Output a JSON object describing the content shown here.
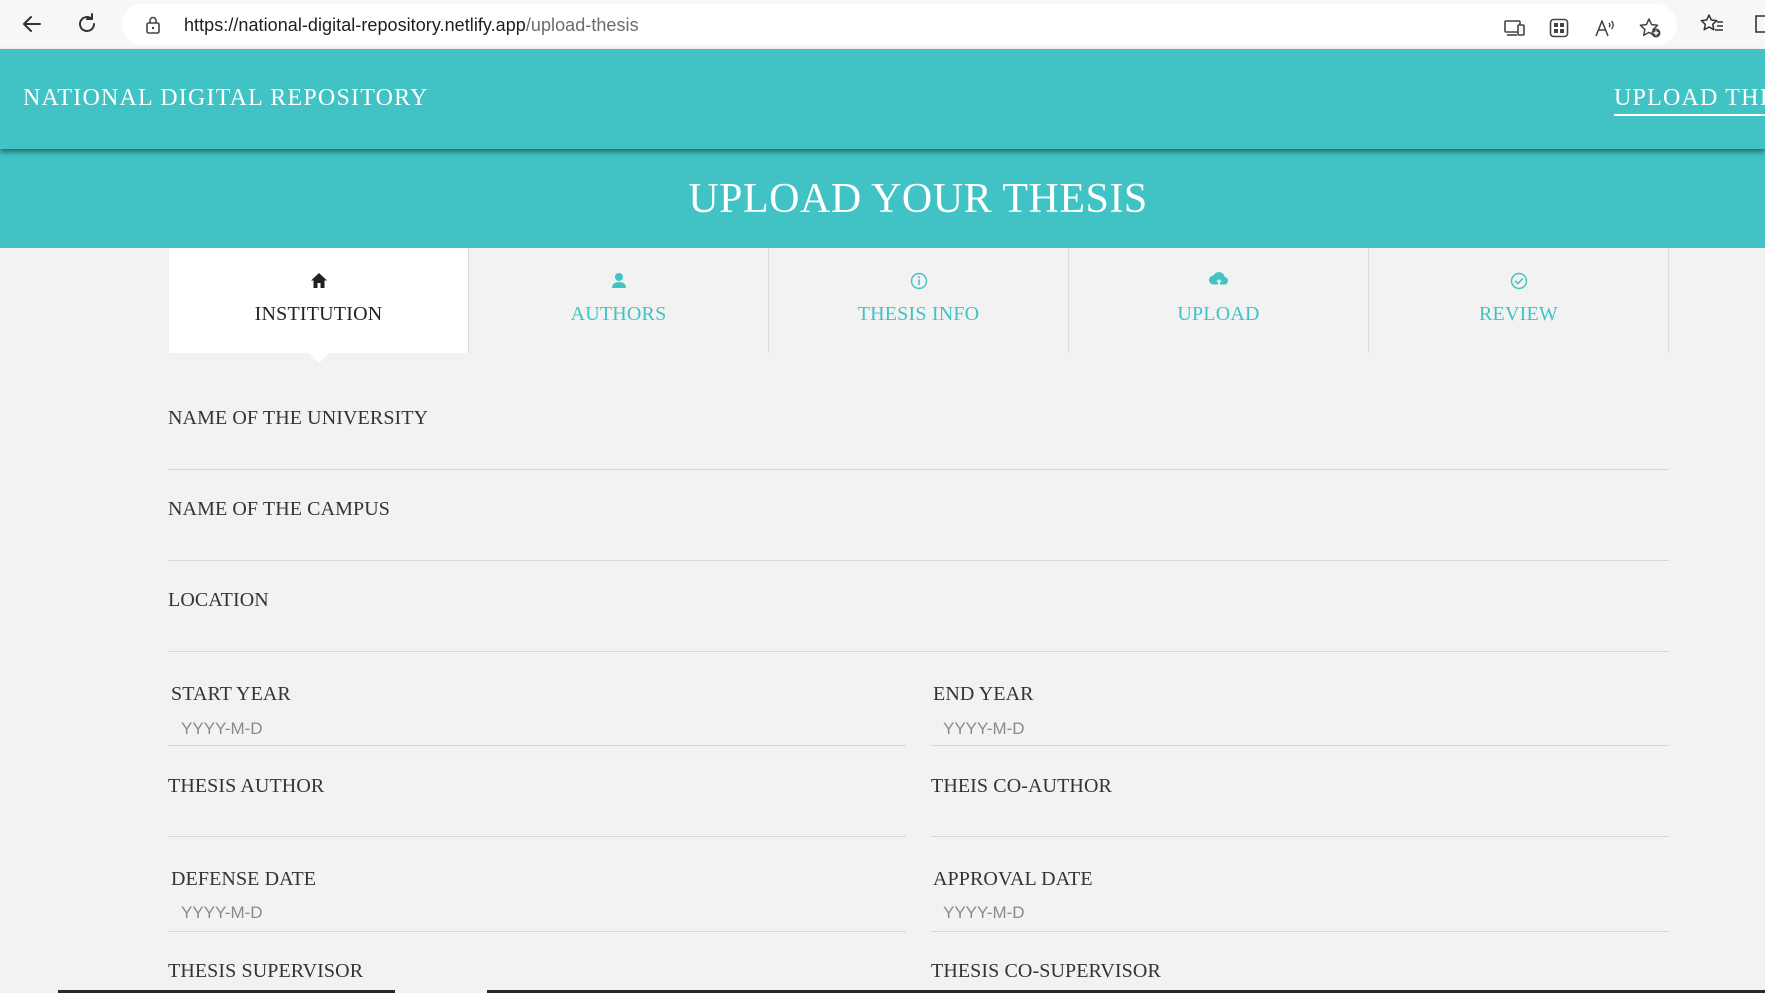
{
  "browser": {
    "url_host": "https://national-digital-repository.netlify.app",
    "url_path": "/upload-thesis",
    "icons": [
      "back-arrow-icon",
      "refresh-icon",
      "lock-icon",
      "device-icon",
      "apps-grid-icon",
      "read-aloud-icon",
      "add-favorite-icon",
      "favorites-icon",
      "extension-icon"
    ]
  },
  "header": {
    "brand": "NATIONAL DIGITAL REPOSITORY",
    "link": "UPLOAD THI",
    "bg_color": "#41c3c5"
  },
  "page": {
    "title": "UPLOAD YOUR THESIS"
  },
  "tabs": [
    {
      "label": "INSTITUTION",
      "icon": "home-icon",
      "active": true
    },
    {
      "label": "AUTHORS",
      "icon": "user-icon",
      "active": false
    },
    {
      "label": "THESIS INFO",
      "icon": "info-icon",
      "active": false
    },
    {
      "label": "UPLOAD",
      "icon": "cloud-upload-icon",
      "active": false
    },
    {
      "label": "REVIEW",
      "icon": "check-circle-icon",
      "active": false
    }
  ],
  "form": {
    "university": {
      "label": "NAME OF THE UNIVERSITY",
      "value": ""
    },
    "campus": {
      "label": "NAME OF THE CAMPUS",
      "value": ""
    },
    "location": {
      "label": "LOCATION",
      "value": ""
    },
    "start_year": {
      "label": "START YEAR",
      "placeholder": "YYYY-M-D"
    },
    "end_year": {
      "label": "END YEAR",
      "placeholder": "YYYY-M-D"
    },
    "author": {
      "label": "THESIS AUTHOR",
      "value": ""
    },
    "co_author": {
      "label": "THEIS CO-AUTHOR",
      "value": ""
    },
    "defense_date": {
      "label": "DEFENSE DATE",
      "placeholder": "YYYY-M-D"
    },
    "approval_date": {
      "label": "APPROVAL DATE",
      "placeholder": "YYYY-M-D"
    },
    "supervisor": {
      "label": "THESIS SUPERVISOR",
      "value": ""
    },
    "co_supervisor": {
      "label": "THESIS CO-SUPERVISOR",
      "value": ""
    }
  }
}
